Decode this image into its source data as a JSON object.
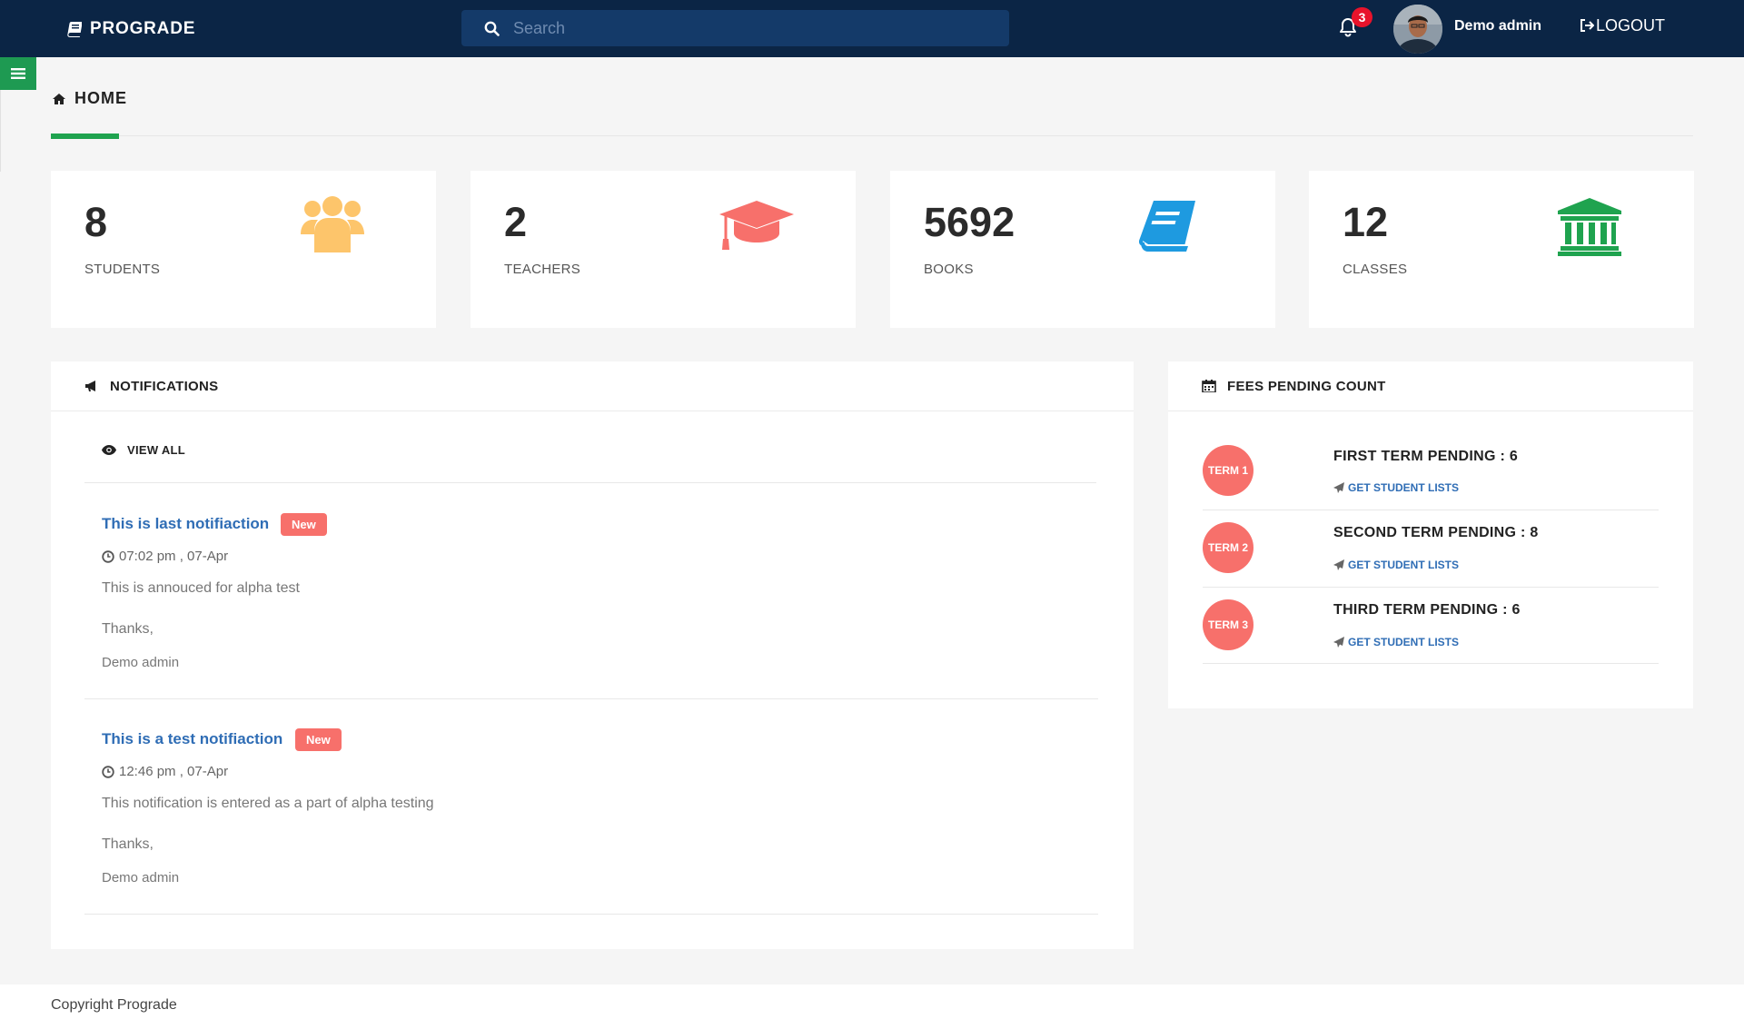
{
  "header": {
    "brand": "PROGRADE",
    "search_placeholder": "Search",
    "notification_count": "3",
    "username": "Demo admin",
    "logout_label": "LOGOUT"
  },
  "page": {
    "title": "HOME"
  },
  "stats": [
    {
      "value": "8",
      "label": "STUDENTS",
      "icon": "users-icon",
      "color": "#fdc56b"
    },
    {
      "value": "2",
      "label": "TEACHERS",
      "icon": "graduation-cap-icon",
      "color": "#f7706b"
    },
    {
      "value": "5692",
      "label": "BOOKS",
      "icon": "book-icon",
      "color": "#1e9ae0"
    },
    {
      "value": "12",
      "label": "CLASSES",
      "icon": "institution-icon",
      "color": "#1fa34f"
    }
  ],
  "notifications": {
    "title": "NOTIFICATIONS",
    "view_all": "VIEW ALL",
    "items": [
      {
        "title": "This is last notifiaction",
        "badge": "New",
        "time": "07:02 pm , 07-Apr",
        "body": "This is annouced for alpha test",
        "closing": "Thanks,",
        "author": "Demo admin"
      },
      {
        "title": "This is a test notifiaction",
        "badge": "New",
        "time": "12:46 pm , 07-Apr",
        "body": "This notification is entered as a part of alpha testing",
        "closing": "Thanks,",
        "author": "Demo admin"
      }
    ]
  },
  "fees": {
    "title": "FEES PENDING COUNT",
    "terms": [
      {
        "badge": "TERM 1",
        "label": "FIRST TERM PENDING : 6",
        "link": "GET STUDENT LISTS"
      },
      {
        "badge": "TERM 2",
        "label": "SECOND TERM PENDING : 8",
        "link": "GET STUDENT LISTS"
      },
      {
        "badge": "TERM 3",
        "label": "THIRD TERM PENDING : 6",
        "link": "GET STUDENT LISTS"
      }
    ]
  },
  "footer": {
    "copyright": "Copyright Prograde"
  }
}
